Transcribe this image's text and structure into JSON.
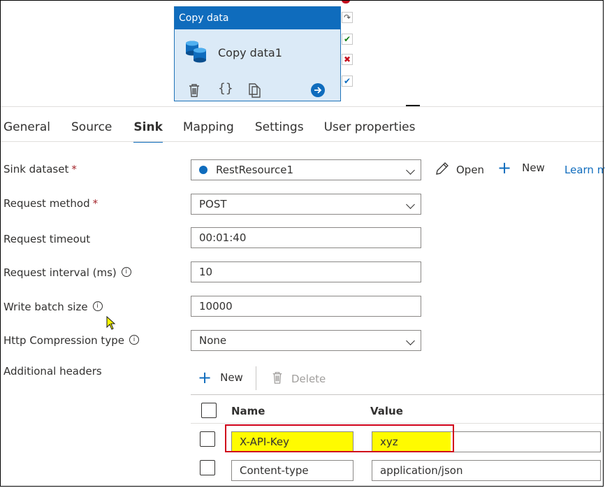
{
  "activity": {
    "type_label": "Copy data",
    "name": "Copy data1"
  },
  "tabs": [
    {
      "label": "General",
      "active": false
    },
    {
      "label": "Source",
      "active": false
    },
    {
      "label": "Sink",
      "active": true
    },
    {
      "label": "Mapping",
      "active": false
    },
    {
      "label": "Settings",
      "active": false
    },
    {
      "label": "User properties",
      "active": false
    }
  ],
  "form": {
    "sink_dataset": {
      "label": "Sink dataset",
      "required_mark": "*",
      "value": "RestResource1"
    },
    "request_method": {
      "label": "Request method",
      "required_mark": "*",
      "value": "POST"
    },
    "request_timeout": {
      "label": "Request timeout",
      "value": "00:01:40"
    },
    "request_interval": {
      "label": "Request interval (ms)",
      "value": "10"
    },
    "write_batch_size": {
      "label": "Write batch size",
      "value": "10000"
    },
    "http_compression": {
      "label": "Http Compression type",
      "value": "None"
    },
    "additional_headers": {
      "label": "Additional headers"
    }
  },
  "dataset_actions": {
    "open_label": "Open",
    "new_label": "New",
    "learn_label": "Learn m"
  },
  "headers": {
    "new_label": "New",
    "delete_label": "Delete",
    "columns": {
      "name": "Name",
      "value": "Value"
    },
    "rows": [
      {
        "name": "X-API-Key",
        "value": "xyz",
        "highlighted": true
      },
      {
        "name": "Content-type",
        "value": "application/json",
        "highlighted": false
      }
    ]
  },
  "colors": {
    "accent": "#0f6cbd",
    "highlight": "#fffb00",
    "annotation": "#d0021b"
  }
}
